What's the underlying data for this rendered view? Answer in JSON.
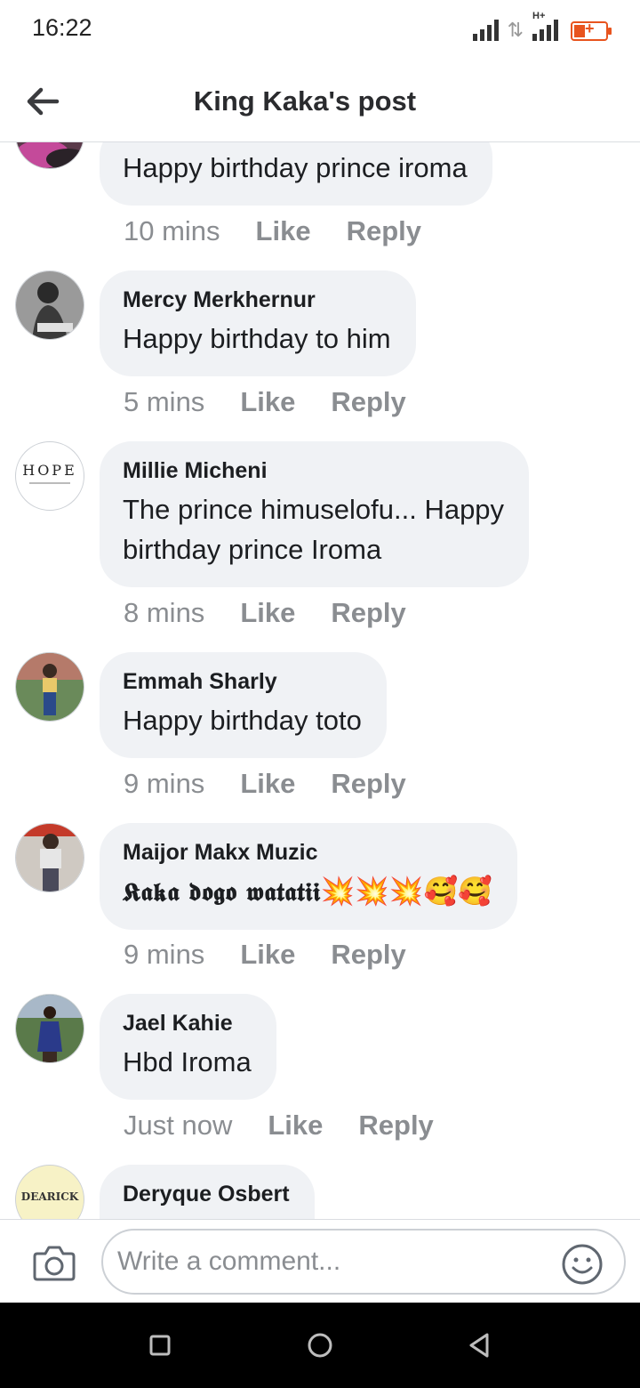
{
  "status_bar": {
    "time": "16:22"
  },
  "header": {
    "title": "King Kaka's post"
  },
  "comments": [
    {
      "text": "Happy birthday prince iroma",
      "time": "10 mins",
      "like": "Like",
      "reply": "Reply",
      "avatar": "partial-photo"
    },
    {
      "name": "Mercy Merkhernur",
      "text": "Happy birthday to him",
      "time": "5 mins",
      "like": "Like",
      "reply": "Reply",
      "avatar": "grayscale-photo"
    },
    {
      "name": "Millie Micheni",
      "text": "The prince himuselofu... Happy\nbirthday prince Iroma",
      "time": "8 mins",
      "like": "Like",
      "reply": "Reply",
      "avatar": "hope-logo",
      "avatar_text": "HOPE"
    },
    {
      "name": "Emmah Sharly",
      "text": "Happy birthday toto",
      "time": "9 mins",
      "like": "Like",
      "reply": "Reply",
      "avatar": "person-photo"
    },
    {
      "name": "Maijor Makx Muzic",
      "text": "𝕶𝖆𝖐𝖆 𝖉𝖔𝖌𝖔 𝖜𝖆𝖙𝖆𝖙𝖎𝖎",
      "emojis": "💥💥💥🥰🥰",
      "time": "9 mins",
      "like": "Like",
      "reply": "Reply",
      "avatar": "person-photo"
    },
    {
      "name": "Jael Kahie",
      "text": "Hbd Iroma",
      "time": "Just now",
      "like": "Like",
      "reply": "Reply",
      "avatar": "person-photo"
    },
    {
      "name": "Deryque Osbert",
      "avatar": "deareck-logo",
      "avatar_text": "DEARICK"
    }
  ],
  "composer": {
    "placeholder": "Write a comment..."
  },
  "icons": {
    "back": "back-arrow-icon",
    "camera": "camera-icon",
    "emoji": "smiley-icon",
    "nav": [
      "recents-square-icon",
      "home-circle-icon",
      "back-triangle-icon"
    ]
  },
  "colors": {
    "bubble": "#f0f2f5",
    "meta": "#8a8d91",
    "battery": "#e8541e"
  }
}
